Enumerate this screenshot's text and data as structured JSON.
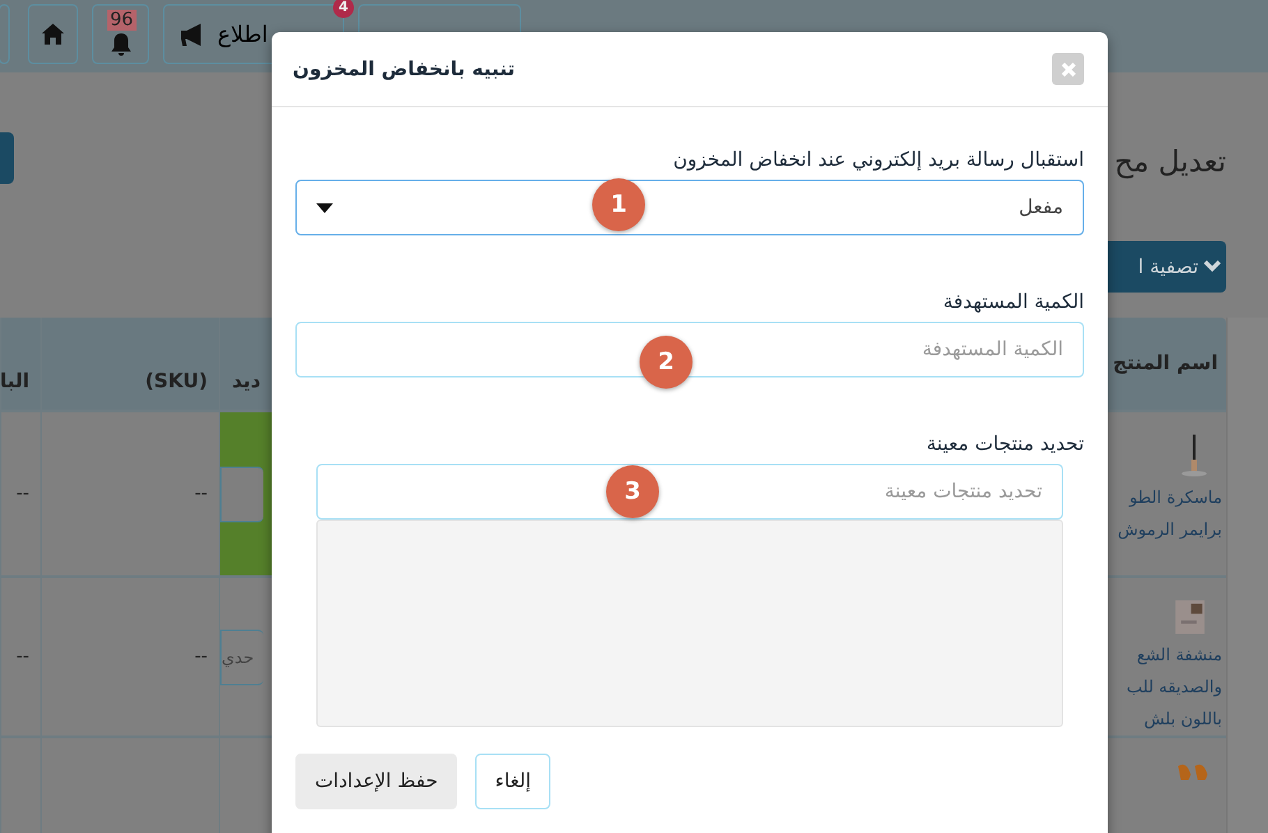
{
  "top_bar": {
    "items": [
      {
        "kind": "blank"
      },
      {
        "kind": "announcement",
        "label": "اطلاع",
        "badge": "4"
      },
      {
        "kind": "notifications",
        "badge": "96"
      },
      {
        "kind": "home"
      },
      {
        "kind": "blank"
      }
    ]
  },
  "page": {
    "title": "تعديل مح",
    "filter_button": "تصفية ا",
    "table": {
      "columns_left": [
        "ديد",
        "(SKU)",
        "البا"
      ],
      "column_right": "اسم المنتج",
      "rows": [
        {
          "cells": [
            "--",
            "--"
          ],
          "highlighted": true,
          "stock_placeholder": "",
          "name_lines": [
            "ماسكرة الطو",
            "برايمر الرموش"
          ]
        },
        {
          "cells": [
            "--",
            "--"
          ],
          "highlighted": false,
          "stock_placeholder": "حدي",
          "name_lines": [
            "منشفة الشع",
            "والصديقه للب",
            "باللون بلش"
          ]
        },
        {
          "cells": [],
          "highlighted": false,
          "name_lines": []
        }
      ]
    }
  },
  "dialog": {
    "title": "تنبيه بانخفاض المخزون",
    "email_label": "استقبال رسالة بريد إلكتروني عند انخفاض المخزون",
    "email_value": "مفعل",
    "quantity_label": "الكمية المستهدفة",
    "quantity_placeholder": "الكمية المستهدفة",
    "products_label": "تحديد منتجات معينة",
    "products_placeholder": "تحديد منتجات معينة",
    "markers": [
      "1",
      "2",
      "3"
    ],
    "buttons": [
      {
        "kind": "outline",
        "label": "إلغاء"
      },
      {
        "kind": "primary",
        "label": "حفظ الإعدادات"
      }
    ]
  }
}
